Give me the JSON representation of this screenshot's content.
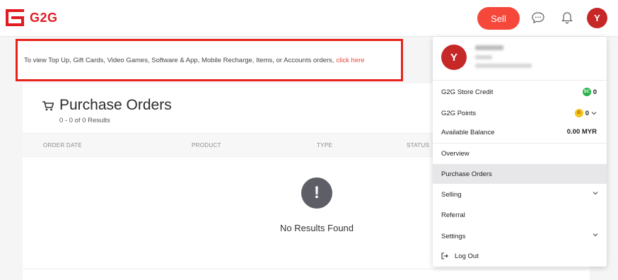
{
  "header": {
    "brand": "G2G",
    "sell_label": "Sell",
    "avatar_initial": "Y",
    "icons": [
      "chat-icon",
      "bell-icon"
    ]
  },
  "notice": {
    "text": "To view Top Up, Gift Cards, Video Games, Software & App, Mobile Recharge, Items, or Accounts orders,",
    "link": "click here"
  },
  "purchase_orders": {
    "title": "Purchase Orders",
    "results": "0 - 0 of 0 Results",
    "columns": [
      "ORDER DATE",
      "PRODUCT",
      "TYPE",
      "STATUS"
    ],
    "empty_text": "No Results Found",
    "empty_glyph": "!"
  },
  "dropdown": {
    "avatar_initial": "Y",
    "store_credit": {
      "label": "G2G Store Credit",
      "value": "0",
      "badge": "SC"
    },
    "points": {
      "label": "G2G Points",
      "value": "0",
      "badge": "G"
    },
    "balance": {
      "label": "Available Balance",
      "value": "0.00 MYR"
    },
    "menu": {
      "overview": "Overview",
      "purchase_orders": "Purchase Orders",
      "selling": "Selling",
      "referral": "Referral",
      "settings": "Settings",
      "logout": "Log Out"
    }
  },
  "colors": {
    "brand": "#e11b22",
    "sell": "#f5483b",
    "highlight_border": "#e8221b",
    "link": "#e5483b",
    "store_credit_badge": "#27b24a",
    "points_badge": "#f6c21c"
  }
}
